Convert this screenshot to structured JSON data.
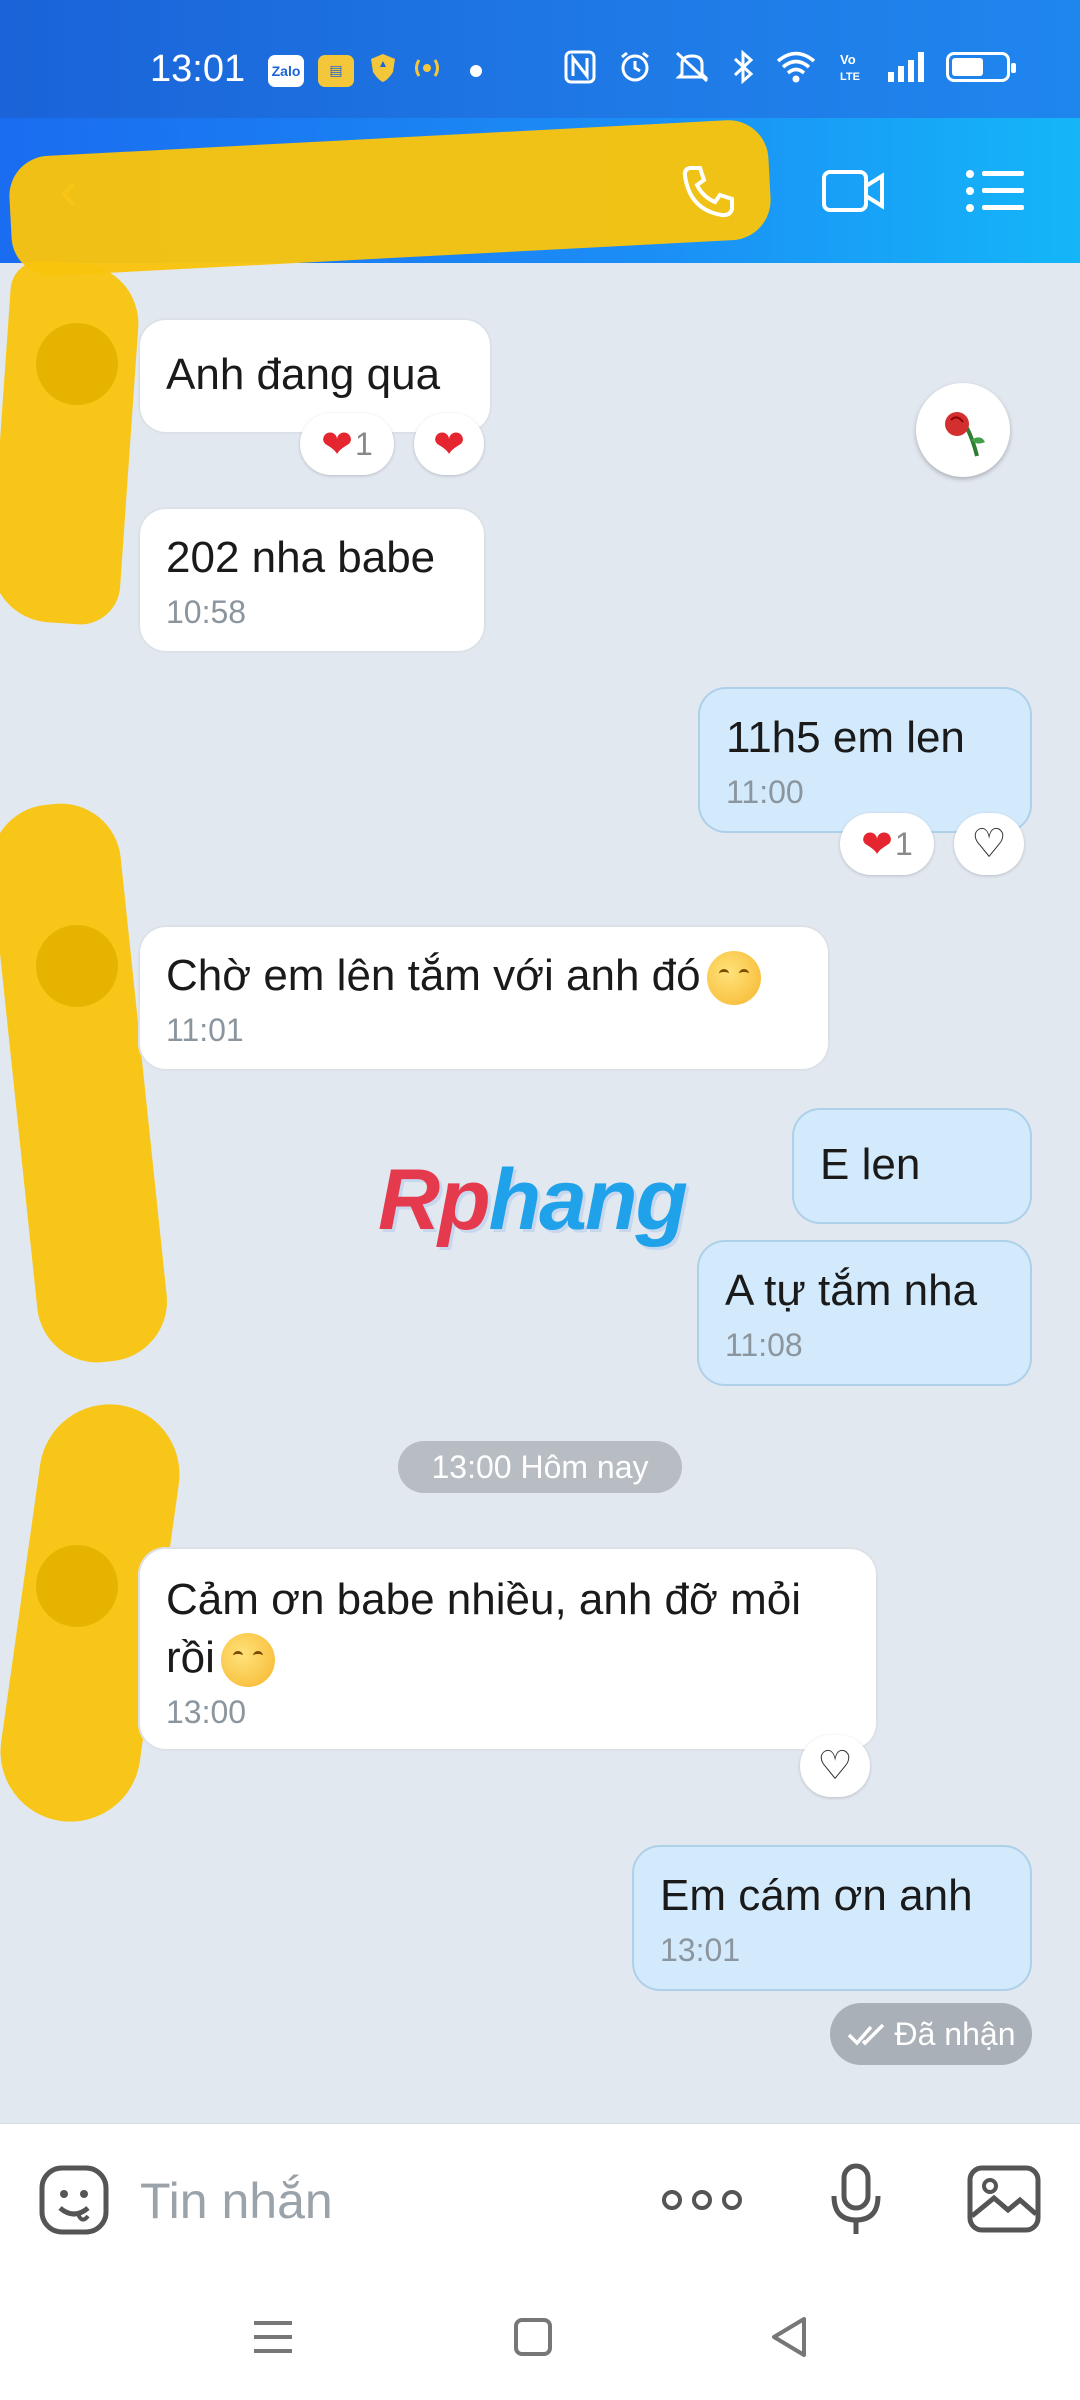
{
  "status_bar": {
    "time": "13:01",
    "app_icons": [
      "Zalo",
      "wallet-icon",
      "shield-icon",
      "hotspot-icon"
    ],
    "right_icons": [
      "nfc-icon",
      "alarm-icon",
      "mute-icon",
      "bluetooth-icon",
      "wifi-icon",
      "volte-icon",
      "signal-icon",
      "battery-icon"
    ],
    "battery_level": 0.6
  },
  "header": {
    "contact_name": "",
    "colors": {
      "start": "#1a6cf0",
      "end": "#14b6f8"
    }
  },
  "messages": [
    {
      "dir": "in",
      "text": "Anh đang qua",
      "time": "",
      "reactions": {
        "heart_count": "1"
      }
    },
    {
      "dir": "in",
      "text": "202 nha babe",
      "time": "10:58"
    },
    {
      "dir": "out",
      "text": "11h5 em len",
      "time": "11:00",
      "reactions": {
        "heart_count": "1"
      }
    },
    {
      "dir": "in",
      "text": "Chờ em lên tắm với anh đó",
      "time": "11:01",
      "emoji": "smile-emoji"
    },
    {
      "dir": "out",
      "text": "E len",
      "time": ""
    },
    {
      "dir": "out",
      "text": "A tự tắm nha",
      "time": "11:08"
    },
    {
      "dir": "in",
      "text_line1": "Cảm ơn babe nhiều, anh đỡ mỏi",
      "text_line2": "rồi",
      "time": "13:00",
      "emoji": "kiss-emoji"
    },
    {
      "dir": "out",
      "text": "Em cám ơn anh",
      "time": "13:01"
    }
  ],
  "date_divider": "13:00 Hôm nay",
  "delivery_status": "Đã nhận",
  "watermark": {
    "part1": "Rp",
    "part2": "hang"
  },
  "input": {
    "placeholder": "Tin nhắn"
  },
  "colors": {
    "incoming": "#ffffff",
    "outgoing": "#d3eafc",
    "background": "#e2e8f0",
    "heart": "#e52530"
  }
}
